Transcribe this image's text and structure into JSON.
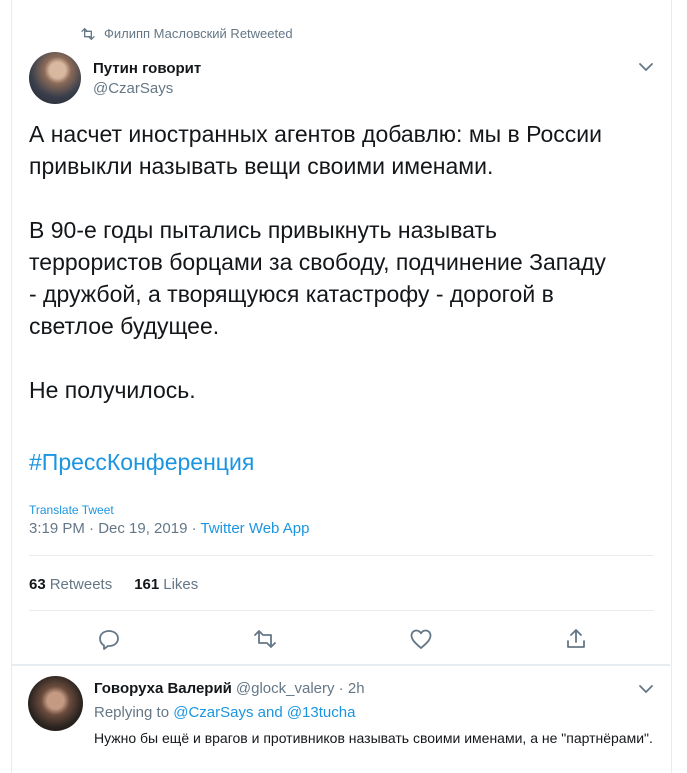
{
  "retweeted_by": "Филипп Масловский Retweeted",
  "tweet": {
    "author_name": "Путин говорит",
    "author_handle": "@CzarSays",
    "paragraphs": [
      "А насчет иностранных агентов добавлю: мы в России привыкли называть вещи своими именами.",
      "В 90-е годы пытались привыкнуть называть террористов борцами за свободу, подчинение Западу - дружбой, а творящуюся катастрофу - дорогой в светлое будущее.",
      "Не получилось."
    ],
    "hashtag": "#ПрессКонференция",
    "translate_label": "Translate Tweet",
    "timestamp": "3:19 PM · Dec 19, 2019 · ",
    "source_app": "Twitter Web App",
    "retweets_count": "63",
    "retweets_label": "Retweets",
    "likes_count": "161",
    "likes_label": "Likes"
  },
  "reply": {
    "author_name": "Говоруха Валерий",
    "author_handle": "@glock_valery",
    "time": " · 2h",
    "replying_prefix": "Replying to ",
    "replying_to": "@CzarSays and @13tucha",
    "text": "Нужно бы ещё и врагов и противников называть своими именами, а не \"партнёрами\"."
  },
  "colors": {
    "link": "#1b95e0",
    "muted": "#657786",
    "text": "#14171a",
    "border": "#e6ecf0"
  },
  "icons": [
    "retweet-icon",
    "chevron-down-icon",
    "reply-icon",
    "retweet-icon",
    "like-icon",
    "share-icon"
  ]
}
